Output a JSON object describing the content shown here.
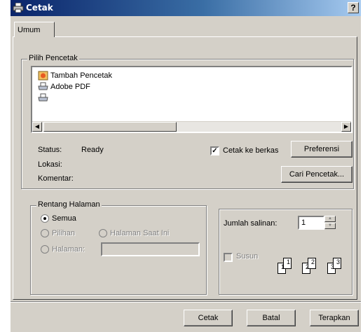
{
  "window": {
    "title": "Cetak",
    "help_label": "?"
  },
  "tabs": [
    {
      "label": "Umum"
    }
  ],
  "printer_group": {
    "legend": "Pilih Pencetak",
    "printers": [
      {
        "label": "Tambah Pencetak",
        "icon": "add-printer-icon"
      },
      {
        "label": "Adobe PDF",
        "icon": "printer-icon"
      },
      {
        "label": "",
        "icon": "printer-icon"
      }
    ],
    "status_label": "Status:",
    "status_value": "Ready",
    "location_label": "Lokasi:",
    "location_value": "",
    "comment_label": "Komentar:",
    "comment_value": "",
    "print_to_file_label": "Cetak ke berkas",
    "print_to_file_checked": true,
    "preferences_button": "Preferensi",
    "find_printer_button": "Cari Pencetak..."
  },
  "page_range": {
    "legend": "Rentang Halaman",
    "all_label": "Semua",
    "selection_label": "Pilihan",
    "current_page_label": "Halaman Saat Ini",
    "pages_label": "Halaman:",
    "pages_value": "",
    "selected": "all"
  },
  "copies": {
    "label": "Jumlah salinan:",
    "value": "1",
    "collate_label": "Susun",
    "collate_checked": false,
    "collate_pages": [
      "1",
      "1",
      "2",
      "2",
      "3",
      "3"
    ]
  },
  "footer": {
    "print_button": "Cetak",
    "cancel_button": "Batal",
    "apply_button": "Terapkan"
  },
  "colors": {
    "title_start": "#0a246a",
    "title_end": "#a6caf0",
    "face": "#d4d0c8"
  }
}
